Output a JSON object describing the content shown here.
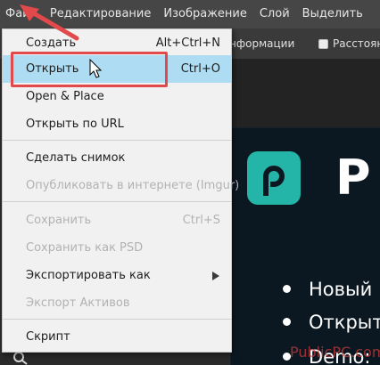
{
  "menubar": {
    "items": [
      "Файл",
      "Редактирование",
      "Изображение",
      "Слой",
      "Выделить"
    ]
  },
  "toolbar": {
    "info_text": "нформации",
    "distance_text": "Расстоян"
  },
  "file_menu": {
    "items": [
      {
        "label": "Создать",
        "shortcut": "Alt+Ctrl+N"
      },
      {
        "label": "Открыть",
        "shortcut": "Ctrl+O"
      },
      {
        "label": "Open & Place"
      },
      {
        "label": "Открыть по URL"
      },
      {
        "label": "Сделать снимок"
      },
      {
        "label": "Опубликовать в интернете (Imgur)"
      },
      {
        "label": "Сохранить",
        "shortcut": "Ctrl+S"
      },
      {
        "label": "Сохранить как PSD"
      },
      {
        "label": "Экспортировать как"
      },
      {
        "label": "Экспорт Активов"
      },
      {
        "label": "Скрипт"
      }
    ]
  },
  "document": {
    "big_letter": "P",
    "bullets": [
      "Новый",
      "Открыт",
      "Demo:"
    ]
  },
  "watermark": "PublicPC.com",
  "colors": {
    "highlight": "#aedcf3",
    "annotation_red": "#e2494a",
    "logo_teal": "#25b4a8"
  }
}
